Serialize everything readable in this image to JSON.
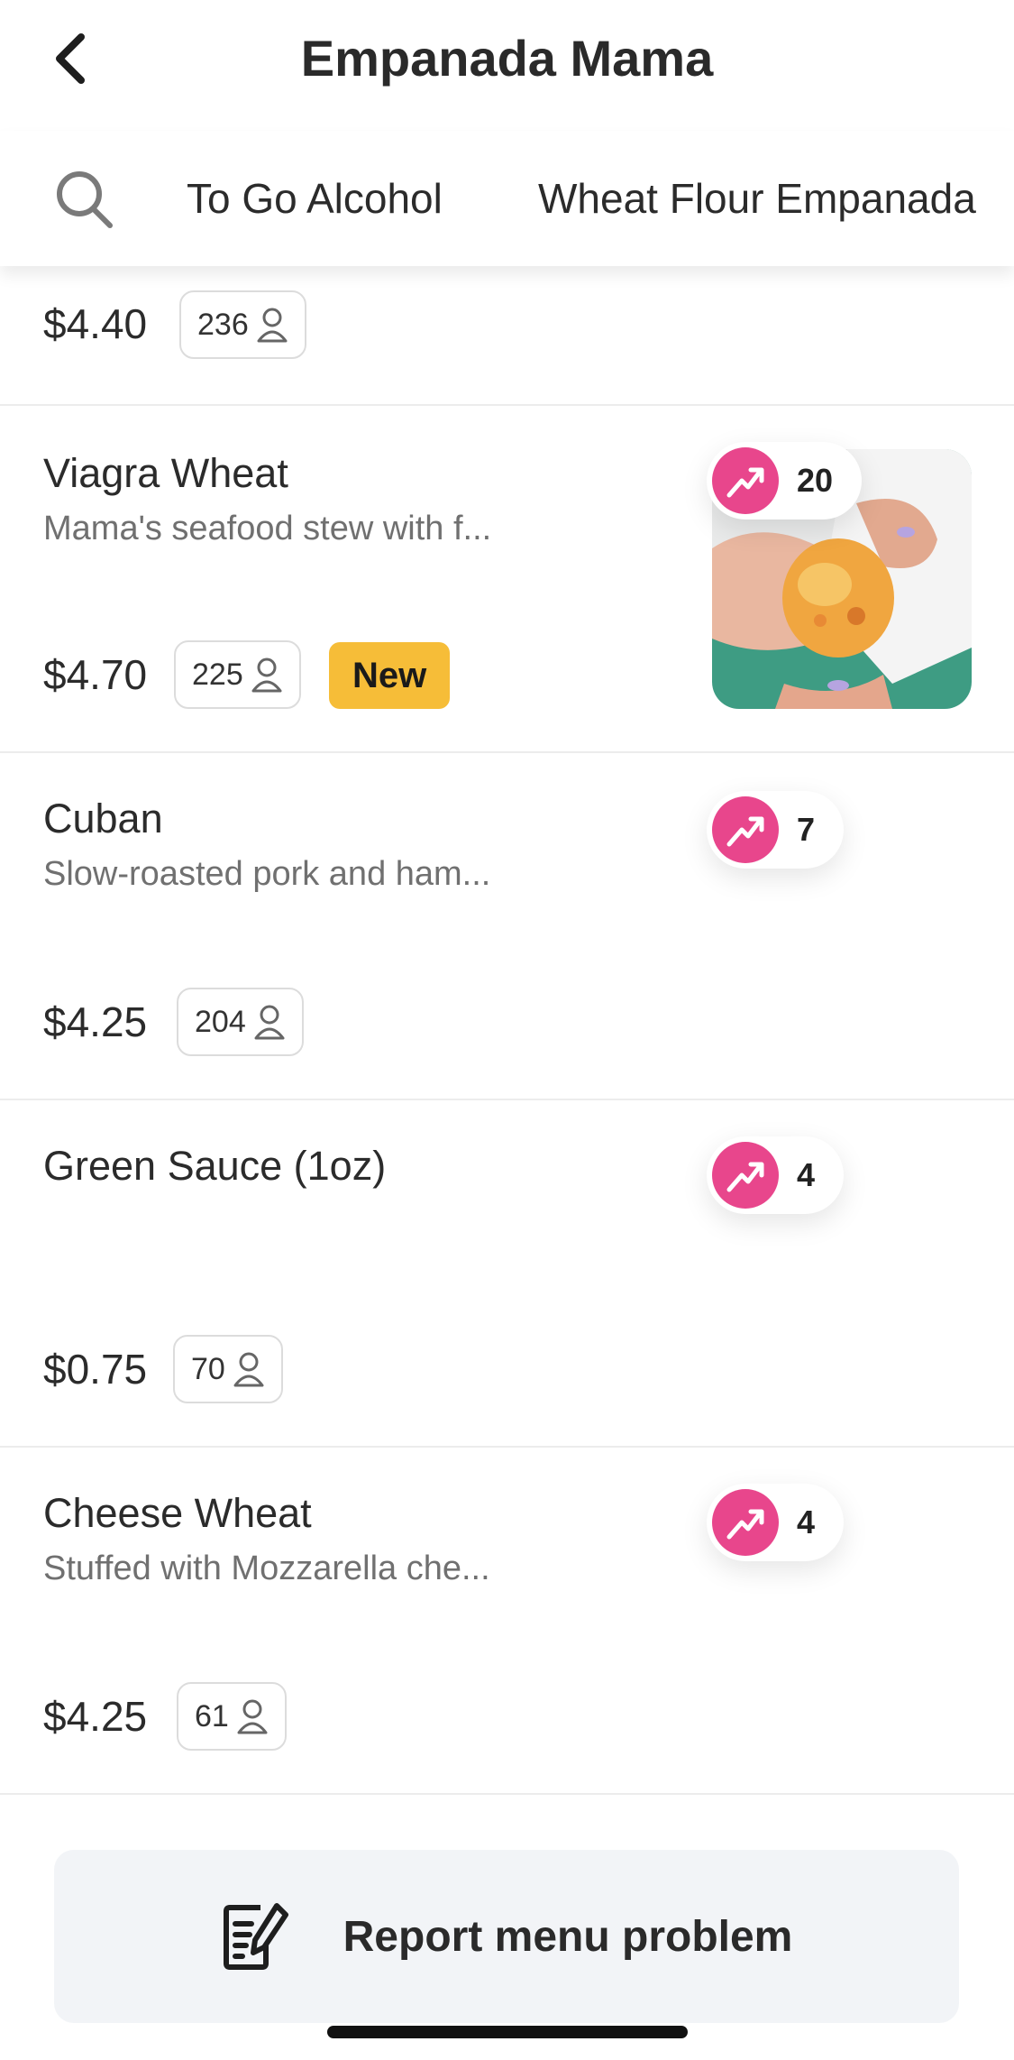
{
  "header": {
    "title": "Empanada Mama",
    "back_icon": "chevron-left-icon"
  },
  "tabs": {
    "search_icon": "search-icon",
    "items": [
      {
        "label": "To Go Alcohol"
      },
      {
        "label": "Wheat Flour Empanada"
      }
    ]
  },
  "menu_items": [
    {
      "name": "",
      "description": "",
      "price": "$4.40",
      "count": "236",
      "new": "",
      "trend": ""
    },
    {
      "name": "Viagra Wheat",
      "description": "Mama's seafood stew with f...",
      "price": "$4.70",
      "count": "225",
      "new": "New",
      "trend": "20"
    },
    {
      "name": "Cuban",
      "description": "Slow-roasted pork and ham...",
      "price": "$4.25",
      "count": "204",
      "new": "",
      "trend": "7"
    },
    {
      "name": "Green Sauce (1oz)",
      "description": "",
      "price": "$0.75",
      "count": "70",
      "new": "",
      "trend": "4"
    },
    {
      "name": "Cheese Wheat",
      "description": "Stuffed with Mozzarella che...",
      "price": "$4.25",
      "count": "61",
      "new": "",
      "trend": "4"
    }
  ],
  "footer": {
    "report_label": "Report menu problem",
    "report_icon": "edit-document-icon"
  },
  "colors": {
    "trend_pink": "#e8468c",
    "new_badge": "#f6bd38",
    "report_bg": "#f2f4f7"
  }
}
